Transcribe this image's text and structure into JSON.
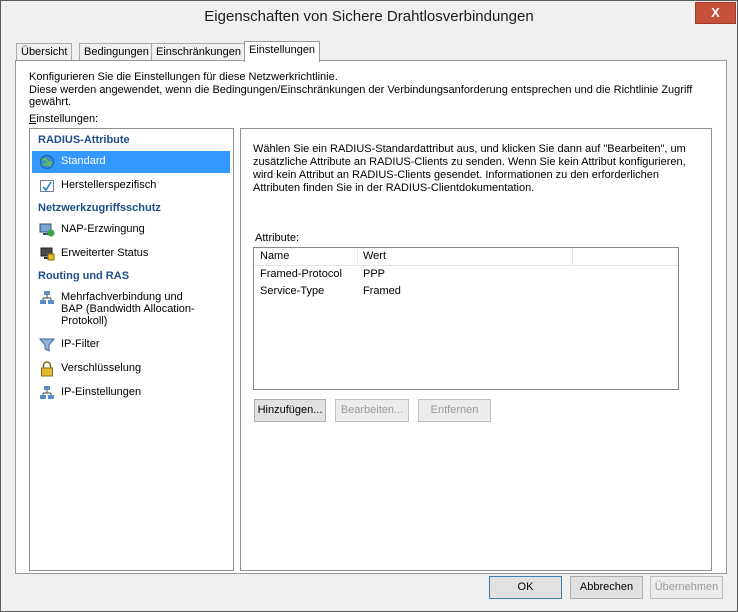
{
  "window": {
    "title": "Eigenschaften von Sichere Drahtlosverbindungen",
    "close_glyph": "X"
  },
  "tabs": [
    "Übersicht",
    "Bedingungen",
    "Einschränkungen",
    "Einstellungen"
  ],
  "active_tab": "Einstellungen",
  "description": {
    "line1": "Konfigurieren Sie die Einstellungen für diese Netzwerkrichtlinie.",
    "line2": "Diese werden angewendet, wenn die Bedingungen/Einschränkungen der Verbindungsanforderung entsprechen und die Richtlinie Zugriff gewährt."
  },
  "settings_label": "Einstellungen:",
  "left_panel": {
    "group1": "RADIUS-Attribute",
    "group1_items": [
      "Standard",
      "Herstellerspezifisch"
    ],
    "group2": "Netzwerkzugriffsschutz",
    "group2_items": [
      "NAP-Erzwingung",
      "Erweiterter Status"
    ],
    "group3": "Routing und RAS",
    "group3_items": [
      "Mehrfachverbindung und",
      "BAP (Bandwidth Allocation-",
      "Protokoll)",
      "IP-Filter",
      "Verschlüsselung",
      "IP-Einstellungen"
    ]
  },
  "right_panel": {
    "description": "Wählen Sie ein RADIUS-Standardattribut aus, und klicken Sie dann auf \"Bearbeiten\", um zusätzliche Attribute an RADIUS-Clients zu senden. Wenn Sie kein Attribut konfigurieren, wird kein Attribut an RADIUS-Clients gesendet. Informationen zu den erforderlichen Attributen finden Sie in der RADIUS-Clientdokumentation.",
    "attributes_label": "Attribute:",
    "columns": [
      "Name",
      "Wert"
    ],
    "rows": [
      {
        "name": "Framed-Protocol",
        "value": "PPP"
      },
      {
        "name": "Service-Type",
        "value": "Framed"
      }
    ],
    "buttons": {
      "add": "Hinzufügen...",
      "edit": "Bearbeiten...",
      "remove": "Entfernen"
    }
  },
  "footer": {
    "ok": "OK",
    "cancel": "Abbrechen",
    "apply": "Übernehmen"
  },
  "colors": {
    "selection": "#3399ff",
    "group_header": "#1e4e8c",
    "close_button": "#c7503b"
  }
}
